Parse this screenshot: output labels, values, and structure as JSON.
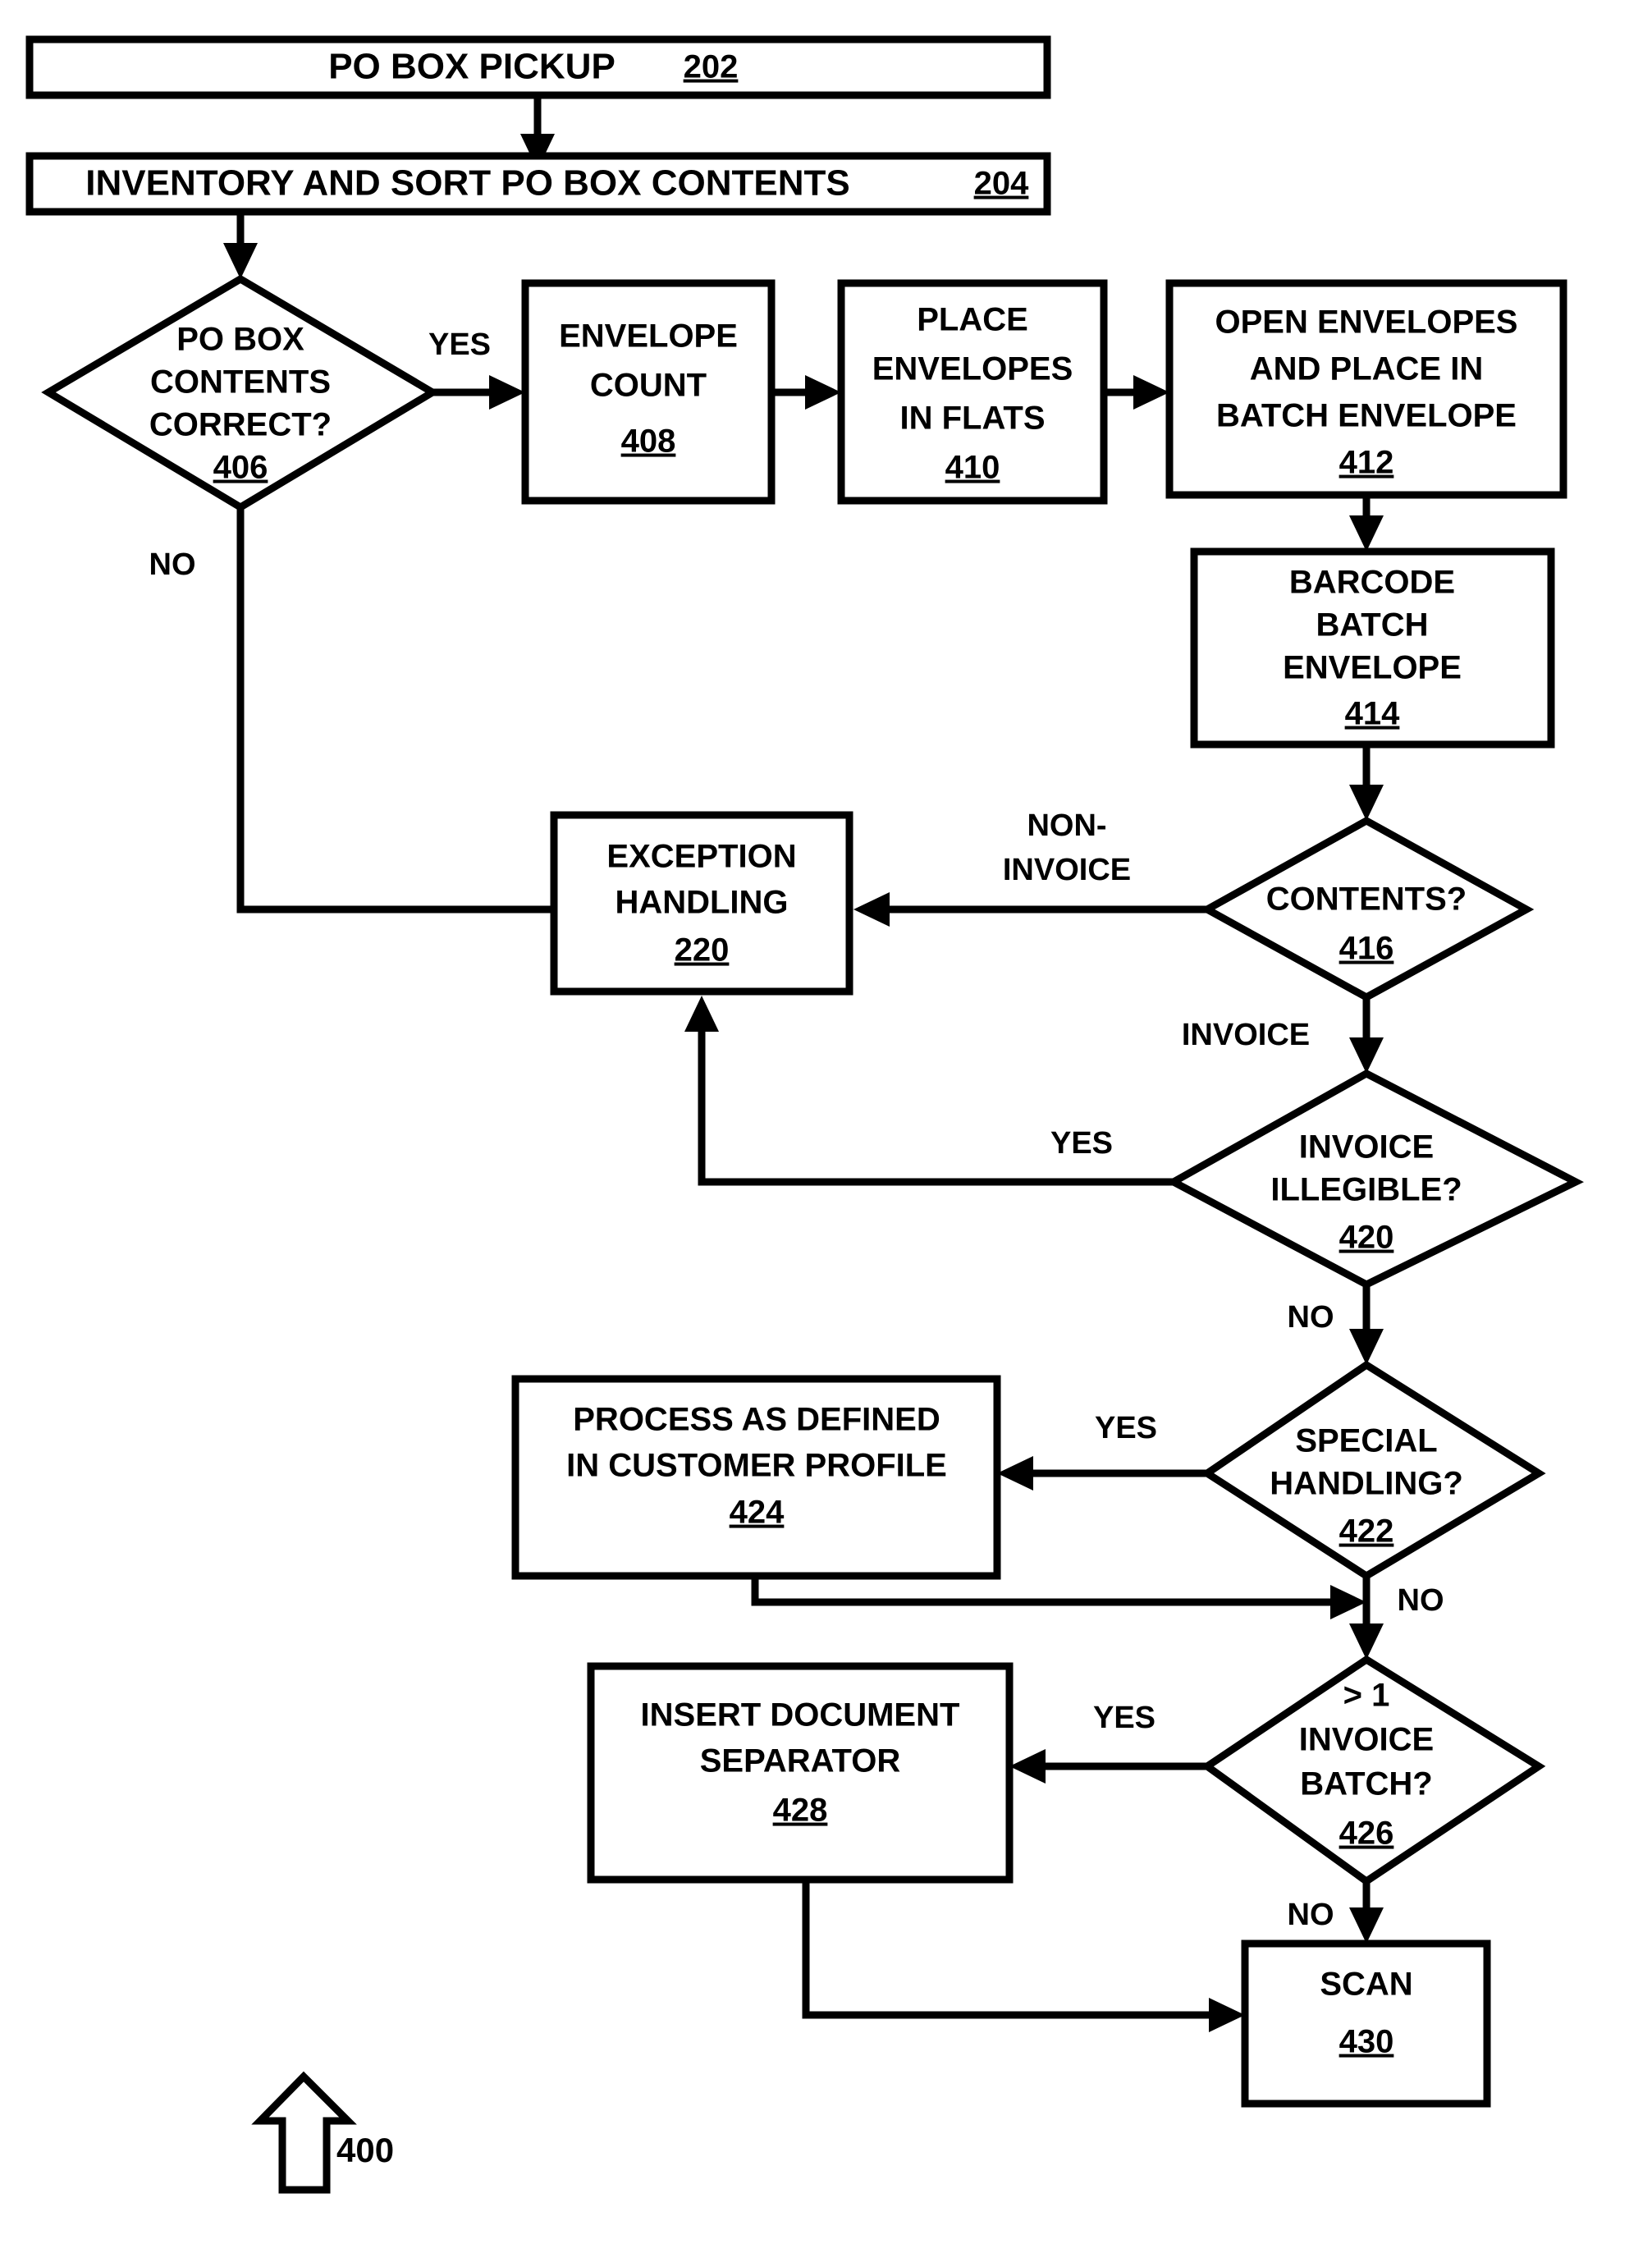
{
  "figure": {
    "label": "400",
    "arrow_icon": "up-arrow-icon"
  },
  "nodes": [
    {
      "id": "n202",
      "type": "process",
      "lines": [
        "PO BOX PICKUP"
      ],
      "ref": "202",
      "inline_ref": true
    },
    {
      "id": "n204",
      "type": "process",
      "lines": [
        "INVENTORY AND SORT PO BOX CONTENTS"
      ],
      "ref": "204",
      "inline_ref": true
    },
    {
      "id": "n406",
      "type": "decision",
      "lines": [
        "PO BOX",
        "CONTENTS",
        "CORRECT?"
      ],
      "ref": "406"
    },
    {
      "id": "n408",
      "type": "process",
      "lines": [
        "ENVELOPE",
        "COUNT"
      ],
      "ref": "408"
    },
    {
      "id": "n410",
      "type": "process",
      "lines": [
        "PLACE",
        "ENVELOPES",
        "IN FLATS"
      ],
      "ref": "410"
    },
    {
      "id": "n412",
      "type": "process",
      "lines": [
        "OPEN ENVELOPES",
        "AND PLACE IN",
        "BATCH ENVELOPE"
      ],
      "ref": "412"
    },
    {
      "id": "n414",
      "type": "process",
      "lines": [
        "BARCODE",
        "BATCH",
        "ENVELOPE"
      ],
      "ref": "414"
    },
    {
      "id": "n220",
      "type": "process",
      "lines": [
        "EXCEPTION",
        "HANDLING"
      ],
      "ref": "220"
    },
    {
      "id": "n416",
      "type": "decision",
      "lines": [
        "CONTENTS?"
      ],
      "ref": "416"
    },
    {
      "id": "n420",
      "type": "decision",
      "lines": [
        "INVOICE",
        "ILLEGIBLE?"
      ],
      "ref": "420"
    },
    {
      "id": "n422",
      "type": "decision",
      "lines": [
        "SPECIAL",
        "HANDLING?"
      ],
      "ref": "422"
    },
    {
      "id": "n424",
      "type": "process",
      "lines": [
        "PROCESS AS DEFINED",
        "IN CUSTOMER PROFILE"
      ],
      "ref": "424"
    },
    {
      "id": "n426",
      "type": "decision",
      "lines": [
        "> 1",
        "INVOICE",
        "BATCH?"
      ],
      "ref": "426"
    },
    {
      "id": "n428",
      "type": "process",
      "lines": [
        "INSERT DOCUMENT",
        "SEPARATOR"
      ],
      "ref": "428"
    },
    {
      "id": "n430",
      "type": "process",
      "lines": [
        "SCAN"
      ],
      "ref": "430"
    }
  ],
  "edge_labels": {
    "e406_yes": "YES",
    "e406_no": "NO",
    "e416_noninvoice_line1": "NON-",
    "e416_noninvoice_line2": "INVOICE",
    "e416_invoice": "INVOICE",
    "e420_yes": "YES",
    "e420_no": "NO",
    "e422_yes": "YES",
    "e422_no": "NO",
    "e426_yes": "YES",
    "e426_no": "NO"
  },
  "colors": {
    "stroke": "#000000",
    "fill": "#ffffff",
    "background": "#ffffff"
  }
}
